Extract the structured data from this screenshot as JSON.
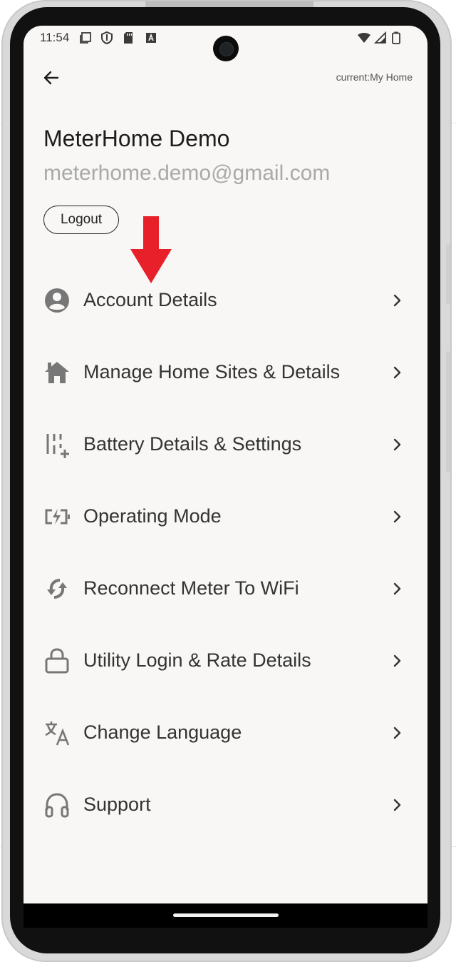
{
  "status_bar": {
    "time": "11:54",
    "left_icons": [
      "copy-icon",
      "shield-icon",
      "sd-card-icon",
      "font-a-icon"
    ],
    "right_icons": [
      "wifi-icon",
      "signal-icon",
      "battery-icon"
    ]
  },
  "header": {
    "back_icon": "arrow-left-icon",
    "current_home": "current:My Home"
  },
  "profile": {
    "name": "MeterHome Demo",
    "email": "meterhome.demo@gmail.com",
    "logout_label": "Logout"
  },
  "annotation": {
    "arrow_color": "#e8202a"
  },
  "menu": {
    "items": [
      {
        "label": "Account Details",
        "icon": "account-circle-icon"
      },
      {
        "label": "Manage Home Sites & Details",
        "icon": "home-icon"
      },
      {
        "label": "Battery Details & Settings",
        "icon": "battery-settings-icon"
      },
      {
        "label": "Operating Mode",
        "icon": "battery-charging-icon"
      },
      {
        "label": "Reconnect Meter To WiFi",
        "icon": "sync-icon"
      },
      {
        "label": "Utility Login & Rate Details",
        "icon": "lock-icon"
      },
      {
        "label": "Change Language",
        "icon": "translate-icon"
      },
      {
        "label": "Support",
        "icon": "headphones-icon"
      }
    ]
  },
  "colors": {
    "screen_bg": "#f8f7f5",
    "text_primary": "#1c1c1c",
    "text_muted": "#a9a9a9",
    "icon_gray": "#777777"
  }
}
